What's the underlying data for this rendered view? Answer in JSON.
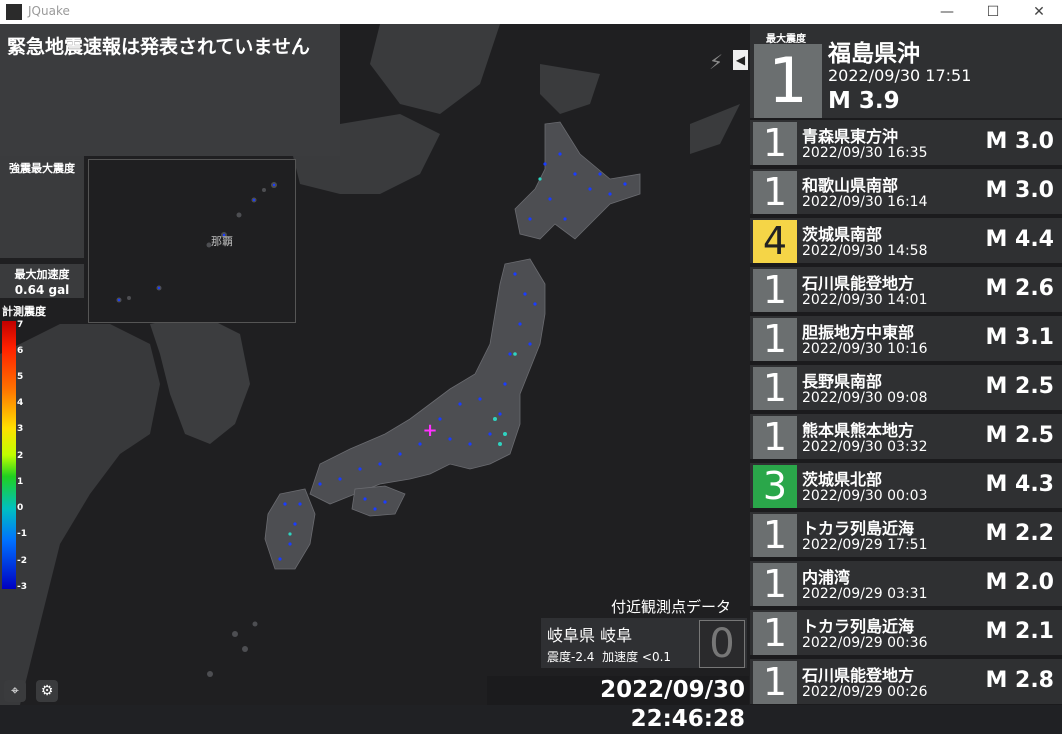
{
  "window": {
    "title": "JQuake",
    "minimize": "—",
    "maximize": "☐",
    "close": "✕"
  },
  "alert": {
    "text": "緊急地震速報は発表されていません"
  },
  "shindo_max": {
    "label": "強震最大震度"
  },
  "inset_map": {
    "label": "那覇"
  },
  "max_accel": {
    "label": "最大加速度",
    "value": "0.64 gal"
  },
  "scale": {
    "title": "計測震度",
    "labels": [
      "7",
      "6",
      "5",
      "4",
      "3",
      "2",
      "1",
      "0",
      "-1",
      "-2",
      "-3"
    ]
  },
  "nearby": {
    "title": "付近観測点データ",
    "station": "岐阜県 岐阜",
    "intensity_label": "震度",
    "intensity_value": "-2.4",
    "accel_label": "加速度",
    "accel_value": "<0.1",
    "intensity_display": "0"
  },
  "clock": "2022/09/30 22:46:28",
  "controls": {
    "bolt_icon": "⚡",
    "collapse_icon": "◀"
  },
  "latest": {
    "label": "最大震度",
    "intensity": "1",
    "region": "福島県沖",
    "time": "2022/09/30  17:51",
    "magnitude": "M 3.9"
  },
  "earthquakes": [
    {
      "intensity": "1",
      "color": "#6b6f70",
      "fg": "#ffffff",
      "region": "青森県東方沖",
      "time": "2022/09/30  16:35",
      "magnitude": "M 3.0"
    },
    {
      "intensity": "1",
      "color": "#6b6f70",
      "fg": "#ffffff",
      "region": "和歌山県南部",
      "time": "2022/09/30  16:14",
      "magnitude": "M 3.0"
    },
    {
      "intensity": "4",
      "color": "#f5d547",
      "fg": "#222222",
      "region": "茨城県南部",
      "time": "2022/09/30  14:58",
      "magnitude": "M 4.4"
    },
    {
      "intensity": "1",
      "color": "#6b6f70",
      "fg": "#ffffff",
      "region": "石川県能登地方",
      "time": "2022/09/30  14:01",
      "magnitude": "M 2.6"
    },
    {
      "intensity": "1",
      "color": "#6b6f70",
      "fg": "#ffffff",
      "region": "胆振地方中東部",
      "time": "2022/09/30  10:16",
      "magnitude": "M 3.1"
    },
    {
      "intensity": "1",
      "color": "#6b6f70",
      "fg": "#ffffff",
      "region": "長野県南部",
      "time": "2022/09/30  09:08",
      "magnitude": "M 2.5"
    },
    {
      "intensity": "1",
      "color": "#6b6f70",
      "fg": "#ffffff",
      "region": "熊本県熊本地方",
      "time": "2022/09/30  03:32",
      "magnitude": "M 2.5"
    },
    {
      "intensity": "3",
      "color": "#2aa74a",
      "fg": "#ffffff",
      "region": "茨城県北部",
      "time": "2022/09/30  00:03",
      "magnitude": "M 4.3"
    },
    {
      "intensity": "1",
      "color": "#6b6f70",
      "fg": "#ffffff",
      "region": "トカラ列島近海",
      "time": "2022/09/29  17:51",
      "magnitude": "M 2.2"
    },
    {
      "intensity": "1",
      "color": "#6b6f70",
      "fg": "#ffffff",
      "region": "内浦湾",
      "time": "2022/09/29  03:31",
      "magnitude": "M 2.0"
    },
    {
      "intensity": "1",
      "color": "#6b6f70",
      "fg": "#ffffff",
      "region": "トカラ列島近海",
      "time": "2022/09/29  00:36",
      "magnitude": "M 2.1"
    },
    {
      "intensity": "1",
      "color": "#6b6f70",
      "fg": "#ffffff",
      "region": "石川県能登地方",
      "time": "2022/09/29  00:26",
      "magnitude": "M 2.8"
    }
  ],
  "bottom_icons": {
    "locate_icon": "⌖",
    "settings_icon": "⚙"
  }
}
